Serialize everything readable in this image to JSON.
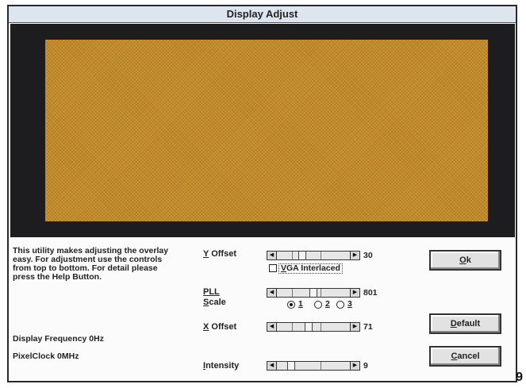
{
  "window": {
    "title": "Display Adjust"
  },
  "description": "This utility makes adjusting the overlay easy. For adjustment use the controls from top to bottom. For detail please press the Help Button.",
  "status": {
    "display_frequency": "Display Frequency 0Hz",
    "pixel_clock": "PixelClock 0MHz"
  },
  "controls": {
    "y_offset": {
      "mnemonic": "Y",
      "label_rest": " Offset",
      "value": "30"
    },
    "vga_interlaced": {
      "mnemonic": "V",
      "label_rest": "GA Interlaced",
      "checked": false
    },
    "pll": {
      "label": "PLL",
      "value": "801"
    },
    "scale": {
      "mnemonic": "S",
      "label_rest": "cale",
      "options": [
        {
          "label": "1",
          "selected": true
        },
        {
          "label": "2",
          "selected": false
        },
        {
          "label": "3",
          "selected": false
        }
      ]
    },
    "x_offset": {
      "mnemonic": "X",
      "label_rest": " Offset",
      "value": "71"
    },
    "intensity": {
      "mnemonic": "I",
      "label_rest": "ntensity",
      "value": "9"
    }
  },
  "buttons": {
    "ok": {
      "mnemonic": "O",
      "label_rest": "k"
    },
    "default": {
      "mnemonic": "D",
      "label_rest": "efault"
    },
    "cancel": {
      "mnemonic": "C",
      "label_rest": "ancel"
    }
  },
  "page_number": "9",
  "colors": {
    "preview_surface": "#c08a2b",
    "preview_frame": "#1d1c1f",
    "title_bar": "#dde5ee"
  },
  "icons": {
    "slider_left": "triangle-left",
    "slider_right": "triangle-right"
  }
}
